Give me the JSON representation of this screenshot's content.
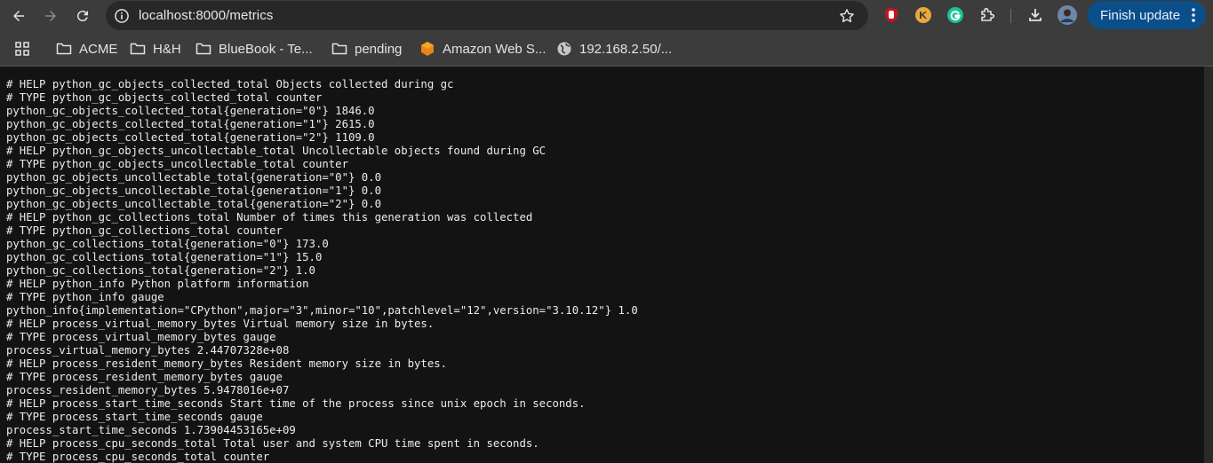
{
  "browser": {
    "url": "localhost:8000/metrics",
    "finish_update_label": "Finish update"
  },
  "bookmarks": [
    {
      "label": "ACME",
      "icon": "folder-icon"
    },
    {
      "label": "H&H",
      "icon": "folder-icon"
    },
    {
      "label": "BlueBook - Te...",
      "icon": "folder-icon"
    },
    {
      "label": "pending",
      "icon": "folder-icon"
    },
    {
      "label": "Amazon Web S...",
      "icon": "aws-icon"
    },
    {
      "label": "192.168.2.50/...",
      "icon": "globe-icon"
    }
  ],
  "colors": {
    "toolbar": "#3c3c3c",
    "omnibox": "#282828",
    "page_bg": "#131313",
    "finish_btn": "#0b4f8a"
  },
  "metrics_lines": [
    "# HELP python_gc_objects_collected_total Objects collected during gc",
    "# TYPE python_gc_objects_collected_total counter",
    "python_gc_objects_collected_total{generation=\"0\"} 1846.0",
    "python_gc_objects_collected_total{generation=\"1\"} 2615.0",
    "python_gc_objects_collected_total{generation=\"2\"} 1109.0",
    "# HELP python_gc_objects_uncollectable_total Uncollectable objects found during GC",
    "# TYPE python_gc_objects_uncollectable_total counter",
    "python_gc_objects_uncollectable_total{generation=\"0\"} 0.0",
    "python_gc_objects_uncollectable_total{generation=\"1\"} 0.0",
    "python_gc_objects_uncollectable_total{generation=\"2\"} 0.0",
    "# HELP python_gc_collections_total Number of times this generation was collected",
    "# TYPE python_gc_collections_total counter",
    "python_gc_collections_total{generation=\"0\"} 173.0",
    "python_gc_collections_total{generation=\"1\"} 15.0",
    "python_gc_collections_total{generation=\"2\"} 1.0",
    "# HELP python_info Python platform information",
    "# TYPE python_info gauge",
    "python_info{implementation=\"CPython\",major=\"3\",minor=\"10\",patchlevel=\"12\",version=\"3.10.12\"} 1.0",
    "# HELP process_virtual_memory_bytes Virtual memory size in bytes.",
    "# TYPE process_virtual_memory_bytes gauge",
    "process_virtual_memory_bytes 2.44707328e+08",
    "# HELP process_resident_memory_bytes Resident memory size in bytes.",
    "# TYPE process_resident_memory_bytes gauge",
    "process_resident_memory_bytes 5.9478016e+07",
    "# HELP process_start_time_seconds Start time of the process since unix epoch in seconds.",
    "# TYPE process_start_time_seconds gauge",
    "process_start_time_seconds 1.73904453165e+09",
    "# HELP process_cpu_seconds_total Total user and system CPU time spent in seconds.",
    "# TYPE process_cpu_seconds_total counter"
  ]
}
